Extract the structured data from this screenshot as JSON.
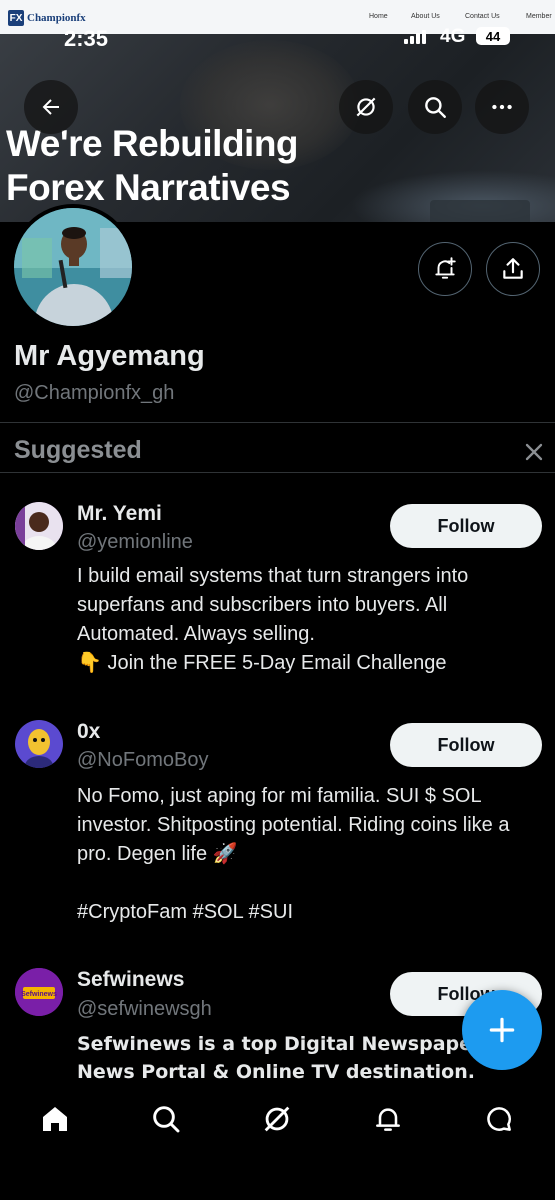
{
  "banner": {
    "site_logo_text": "Championfx",
    "site_logo_mark": "FX",
    "site_nav": [
      "Home",
      "About Us",
      "Contact Us",
      "Member"
    ],
    "headline_line1": "We're Rebuilding",
    "headline_line2": "Forex Narratives"
  },
  "status_bar": {
    "time": "2:35",
    "network": "4G",
    "battery": "44"
  },
  "profile": {
    "name": "Mr Agyemang",
    "handle": "@Championfx_gh"
  },
  "suggested": {
    "title": "Suggested",
    "accounts": [
      {
        "name": "Mr. Yemi",
        "handle": "@yemionline",
        "follow_label": "Follow",
        "bio": "I build email systems that turn strangers into superfans and subscribers into buyers. All Automated. Always selling.\n👇 Join the FREE 5-Day Email Challenge"
      },
      {
        "name": "0x",
        "handle": "@NoFomoBoy",
        "follow_label": "Follow",
        "bio": "No Fomo, just aping for mi familia. SUI $ SOL investor. Shitposting potential. Riding coins like a pro. Degen life 🚀\n\n#CryptoFam #SOL #SUI"
      },
      {
        "name": "Sefwinews",
        "handle": "@sefwinewsgh",
        "follow_label": "Follow",
        "bio": "Sefwinews is a top Digital Newspaper, News Portal & Online TV destination."
      }
    ]
  },
  "sefwi_logo_text": "Sefwinews",
  "colors": {
    "accent": "#1d9bf0",
    "background": "#000000",
    "secondary_text": "#71767b"
  },
  "icons": {
    "back": "arrow-left-icon",
    "grok": "grok-icon",
    "search": "search-icon",
    "more": "more-dots-icon",
    "notify": "bell-plus-icon",
    "share": "share-icon",
    "close": "close-icon",
    "compose": "plus-icon",
    "tabs": [
      "home-icon",
      "search-icon",
      "grok-icon",
      "bell-icon",
      "messages-icon"
    ]
  }
}
